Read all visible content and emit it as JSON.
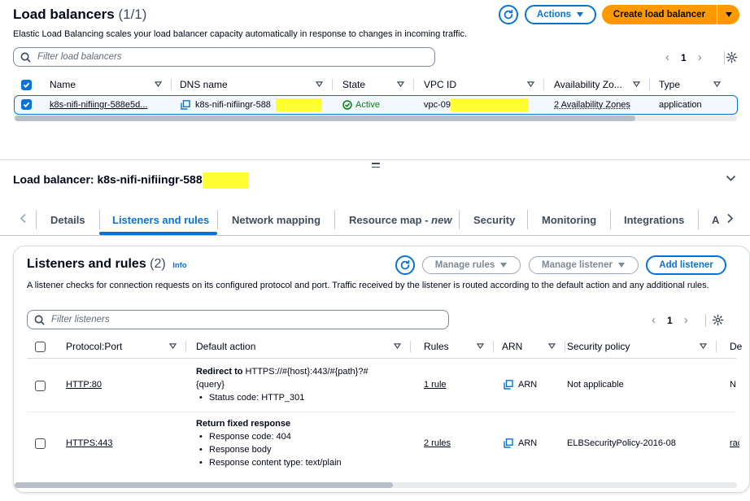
{
  "top": {
    "title": "Load balancers",
    "count": "(1/1)",
    "description": "Elastic Load Balancing scales your load balancer capacity automatically in response to changes in incoming traffic.",
    "actions_label": "Actions",
    "create_label": "Create load balancer",
    "search_placeholder": "Filter load balancers",
    "page": "1",
    "columns": [
      "Name",
      "DNS name",
      "State",
      "VPC ID",
      "Availability Zo...",
      "Type"
    ],
    "row": {
      "name": "k8s-nifi-nifiingr-588e5d...",
      "dns": "k8s-nifi-nifiingr-588",
      "state": "Active",
      "vpc": "vpc-09",
      "az": "2 Availability Zones",
      "type": "application"
    }
  },
  "detail": {
    "title": "Load balancer: k8s-nifi-nifiingr-588",
    "tabs": [
      "Details",
      "Listeners and rules",
      "Network mapping",
      "Resource map - ",
      "Security",
      "Monitoring",
      "Integrations",
      "A"
    ],
    "tab_new": "new",
    "active_tab": "Listeners and rules"
  },
  "listeners": {
    "title": "Listeners and rules",
    "count": "(2)",
    "info": "Info",
    "manage_rules": "Manage rules",
    "manage_listener": "Manage listener",
    "add_listener": "Add listener",
    "description": "A listener checks for connection requests on its configured protocol and port. Traffic received by the listener is routed according to the default action and any additional rules.",
    "search_placeholder": "Filter listeners",
    "page": "1",
    "columns": [
      "Protocol:Port",
      "Default action",
      "Rules",
      "ARN",
      "Security policy",
      "De"
    ],
    "rows": [
      {
        "protocol": "HTTP:80",
        "action_bold": "Redirect to",
        "action_text": " HTTPS://#{host}:443/#{path}?#",
        "action_line2": "{query}",
        "bullets": [
          "Status code: HTTP_301"
        ],
        "rules": "1 rule",
        "arn": "ARN",
        "policy": "Not applicable",
        "extra": "No"
      },
      {
        "protocol": "HTTPS:443",
        "action_bold": "Return fixed response",
        "action_text": "",
        "action_line2": "",
        "bullets": [
          "Response code: 404",
          "Response body",
          "Response content type: text/plain"
        ],
        "rules": "2 rules",
        "arn": "ARN",
        "policy": "ELBSecurityPolicy-2016-08",
        "extra": "rac"
      }
    ]
  },
  "colors": {
    "accent": "#0972d3",
    "primary": "#ff9900",
    "success": "#037f0c",
    "redaction": "#ffff33"
  }
}
